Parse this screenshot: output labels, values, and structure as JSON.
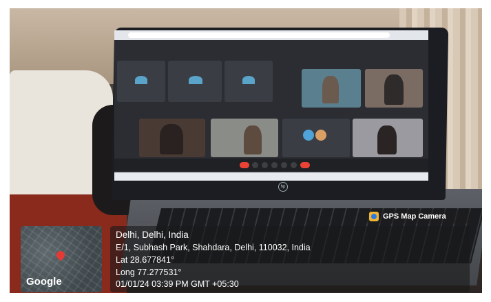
{
  "gps_overlay": {
    "badge_text": "GPS Map Camera",
    "city": "Delhi, Delhi, India",
    "address": "E/1, Subhash Park, Shahdara, Delhi, 110032, India",
    "latitude": "Lat 28.677841°",
    "longitude": "Long 77.277531°",
    "timestamp": "01/01/24 03:39 PM GMT +05:30"
  },
  "map": {
    "logo_text": "Google",
    "pin_color": "#e53935"
  },
  "laptop": {
    "brand_mark": "hp"
  }
}
